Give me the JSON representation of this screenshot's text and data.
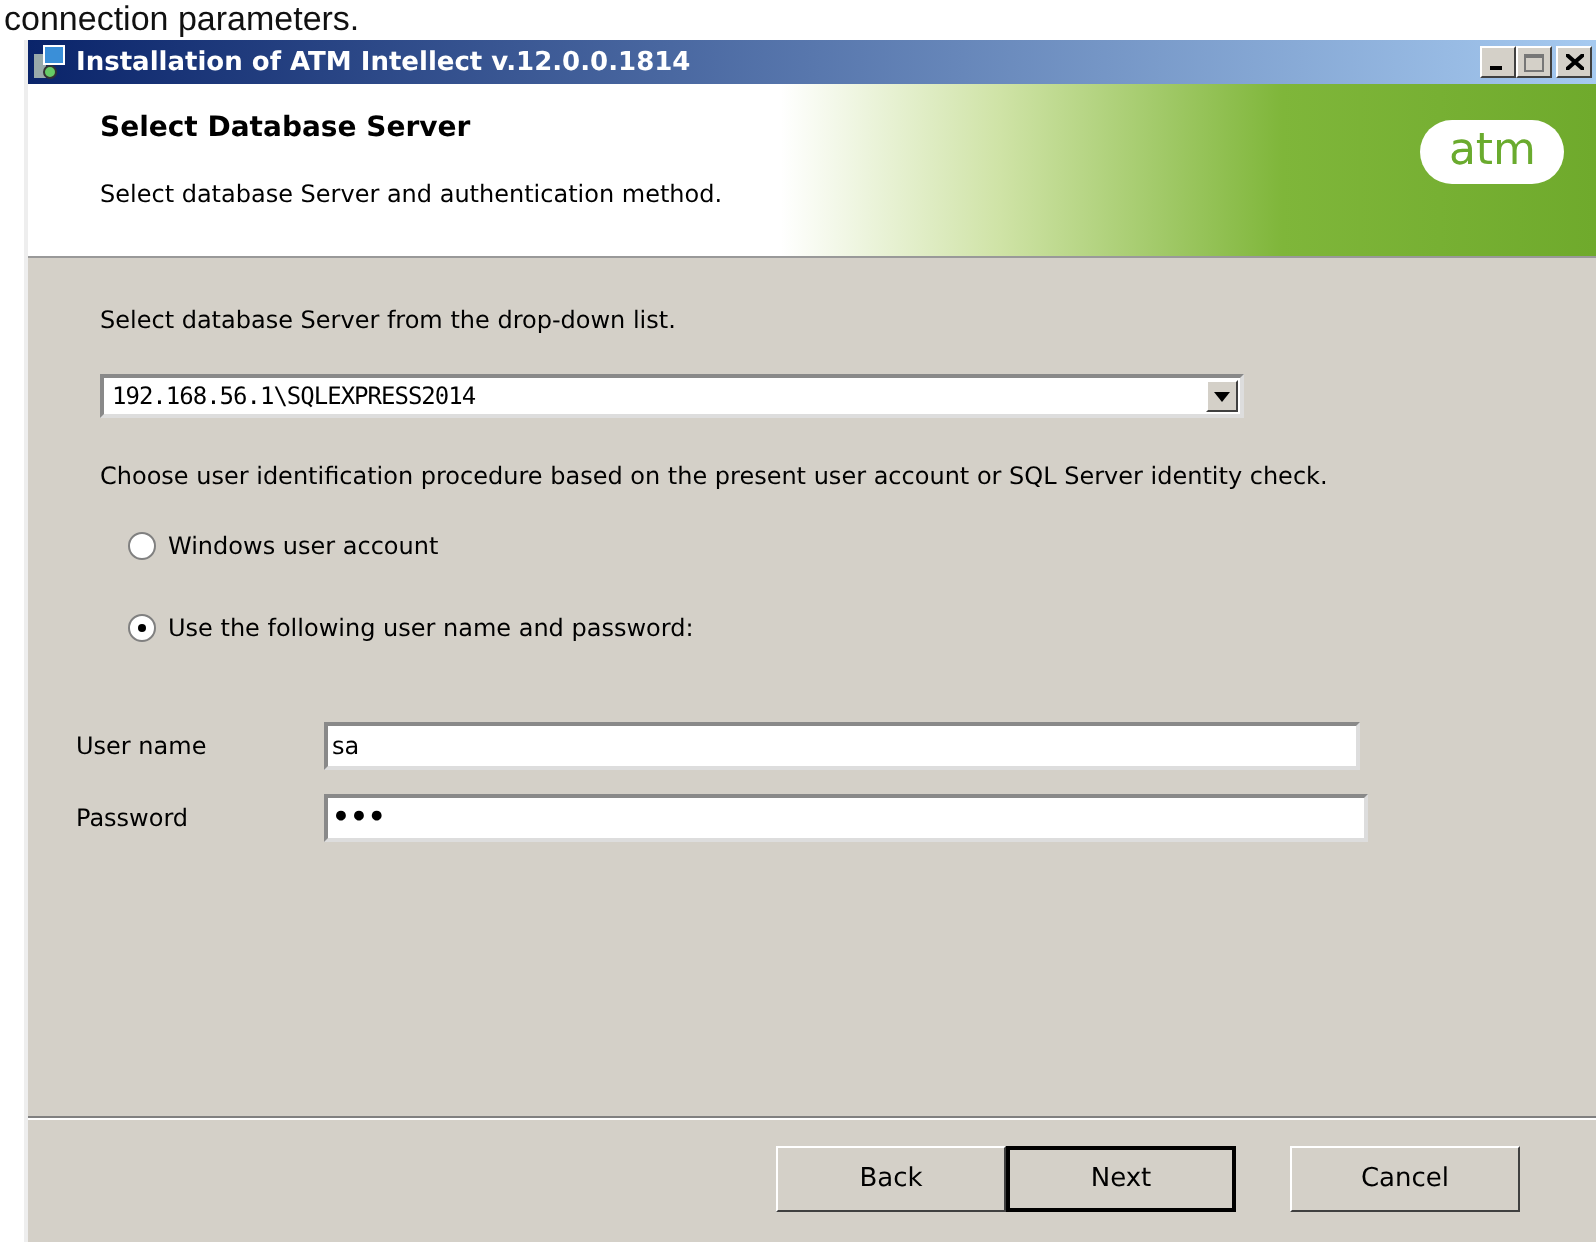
{
  "page_text_above": "connection parameters.",
  "window": {
    "title": "Installation of ATM Intellect v.12.0.0.1814"
  },
  "header": {
    "title": "Select Database Server",
    "subtitle": "Select database Server and authentication method.",
    "logo": "atm"
  },
  "server": {
    "label": "Select database Server from the drop-down list.",
    "value": "192.168.56.1\\SQLEXPRESS2014"
  },
  "auth": {
    "label": "Choose user identification procedure based on the present user account or SQL Server identity check.",
    "options": [
      {
        "label": "Windows user account",
        "selected": false
      },
      {
        "label": "Use the following user name and password:",
        "selected": true
      }
    ]
  },
  "fields": [
    {
      "label": "User name",
      "value": "sa"
    },
    {
      "label": "Password",
      "value": "•••"
    }
  ],
  "buttons": [
    {
      "label": "Back",
      "default": false
    },
    {
      "label": "Next",
      "default": true
    },
    {
      "label": "Cancel",
      "default": false
    }
  ]
}
